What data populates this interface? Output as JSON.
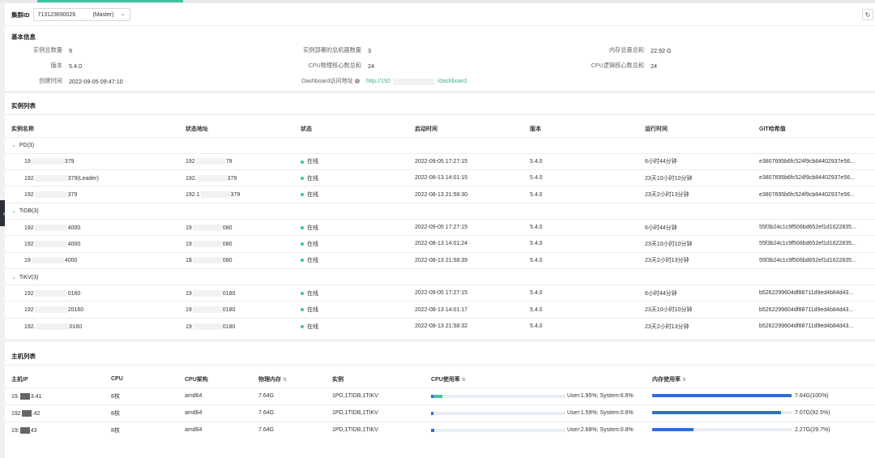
{
  "header": {
    "cluster_id_label": "集群ID",
    "cluster_id_value": "713123690026",
    "cluster_role": "(Master)",
    "refresh_icon": "refresh-icon"
  },
  "basic_info": {
    "title": "基本信息",
    "rows": [
      [
        {
          "label": "实例总数量",
          "value": "9"
        },
        {
          "label": "实例部署的总机器数量",
          "value": "3"
        },
        {
          "label": "内存总量总和",
          "value": "22.92 G"
        }
      ],
      [
        {
          "label": "版本",
          "value": "5.4.0"
        },
        {
          "label": "CPU物理核心数总和",
          "value": "24"
        },
        {
          "label": "CPU逻辑核心数总和",
          "value": "24"
        }
      ],
      [
        {
          "label": "创建时间",
          "value": "2022-09-05 09:47:10"
        },
        {
          "label": "Dashboard访问地址",
          "value_prefix": "http://192",
          "value_suffix": "/dashboard"
        },
        {
          "label": "",
          "value": ""
        }
      ]
    ]
  },
  "instances": {
    "title": "实例列表",
    "columns": [
      "实例名称",
      "状态地址",
      "状态",
      "启动时间",
      "版本",
      "运行时间",
      "GIT哈希值"
    ],
    "groups": [
      {
        "name": "PD(3)",
        "rows": [
          {
            "name_a": "19",
            "name_b": "379",
            "addr_a": "192",
            "addr_b": "79",
            "status": "在线",
            "start": "2022-09-05 17:27:15",
            "version": "5.4.0",
            "uptime": "6小时44分钟",
            "git": "e3807695b6fc524f9cb84402937e56..."
          },
          {
            "name_a": "192",
            "name_b": "379(Leader)",
            "addr_a": "192.",
            "addr_b": "379",
            "status": "在线",
            "start": "2022-08-13 14:01:15",
            "version": "5.4.0",
            "uptime": "23天10小时10分钟",
            "git": "e3807695b6fc524f9cb84402937e56..."
          },
          {
            "name_a": "192",
            "name_b": "379",
            "addr_a": "192.1",
            "addr_b": "379",
            "status": "在线",
            "start": "2022-08-13 21:58:30",
            "version": "5.4.0",
            "uptime": "23天2小时13分钟",
            "git": "e3807695b6fc524f9cb84402937e56..."
          }
        ]
      },
      {
        "name": "TiDB(3)",
        "rows": [
          {
            "name_a": "192",
            "name_b": "4000",
            "addr_a": "19",
            "addr_b": "080",
            "status": "在线",
            "start": "2022-09-05 17:27:15",
            "version": "5.4.0",
            "uptime": "6小时44分钟",
            "git": "55f3b24c1c9f506bd652ef1d1622835..."
          },
          {
            "name_a": "192",
            "name_b": "4000",
            "addr_a": "19",
            "addr_b": "080",
            "status": "在线",
            "start": "2022-08-13 14:01:24",
            "version": "5.4.0",
            "uptime": "23天10小时10分钟",
            "git": "55f3b24c1c9f506bd652ef1d1622835..."
          },
          {
            "name_a": "19",
            "name_b": "4000",
            "addr_a": "1$",
            "addr_b": "080",
            "status": "在线",
            "start": "2022-08-13 21:58:39",
            "version": "5.4.0",
            "uptime": "23天2小时13分钟",
            "git": "55f3b24c1c9f506bd652ef1d1622835..."
          }
        ]
      },
      {
        "name": "TiKV(3)",
        "rows": [
          {
            "name_a": "192",
            "name_b": "0160",
            "addr_a": "19",
            "addr_b": "0180",
            "status": "在线",
            "start": "2022-09-05 17:27:15",
            "version": "5.4.0",
            "uptime": "6小时44分钟",
            "git": "b5262299604df88711d9ed4b84d43..."
          },
          {
            "name_a": "192",
            "name_b": "20160",
            "addr_a": "19",
            "addr_b": "0180",
            "status": "在线",
            "start": "2022-08-13 14:01:17",
            "version": "5.4.0",
            "uptime": "23天10小时10分钟",
            "git": "b5262299604df88711d9ed4b84d43..."
          },
          {
            "name_a": "192.",
            "name_b": "0160",
            "addr_a": "19",
            "addr_b": "0180",
            "status": "在线",
            "start": "2022-08-13 21:58:32",
            "version": "5.4.0",
            "uptime": "23天2小时13分钟",
            "git": "b5262299604df88711d9ed4b84d43..."
          }
        ]
      }
    ]
  },
  "hosts": {
    "title": "主机列表",
    "columns": [
      "主机IP",
      "CPU",
      "CPU架构",
      "物理内存",
      "实例",
      "CPU使用率",
      "内存使用率"
    ],
    "sort_icon": "sort-icon",
    "rows": [
      {
        "ip_a": "19.",
        "ip_b": "3.41",
        "cpu": "8核",
        "arch": "amd64",
        "mem": "7.64G",
        "inst": "1PD,1TIDB,1TIKV",
        "cpu_user": 0.0195,
        "cpu_sys": 0.066,
        "cpu_text": "User:1.95%; System:6.6%",
        "mem_used": 1.0,
        "mem_text": "7.64G(100%)"
      },
      {
        "ip_a": "192",
        "ip_b": ".42",
        "cpu": "8核",
        "arch": "amd64",
        "mem": "7.64G",
        "inst": "1PD,1TIDB,1TIKV",
        "cpu_user": 0.0159,
        "cpu_sys": 0.006,
        "cpu_text": "User:1.59%; System:0.6%",
        "mem_used": 0.925,
        "mem_text": "7.07G(92.5%)"
      },
      {
        "ip_a": "19:",
        "ip_b": "43",
        "cpu": "8核",
        "arch": "amd64",
        "mem": "7.64G",
        "inst": "1PD,1TIDB,1TIKV",
        "cpu_user": 0.0268,
        "cpu_sys": 0.008,
        "cpu_text": "User:2.68%; System:0.8%",
        "mem_used": 0.297,
        "mem_text": "2.27G(29.7%)"
      }
    ]
  },
  "colors": {
    "accent": "#41c2a0",
    "cpu_bar": "#2f6fd0",
    "link": "#41b08e"
  }
}
